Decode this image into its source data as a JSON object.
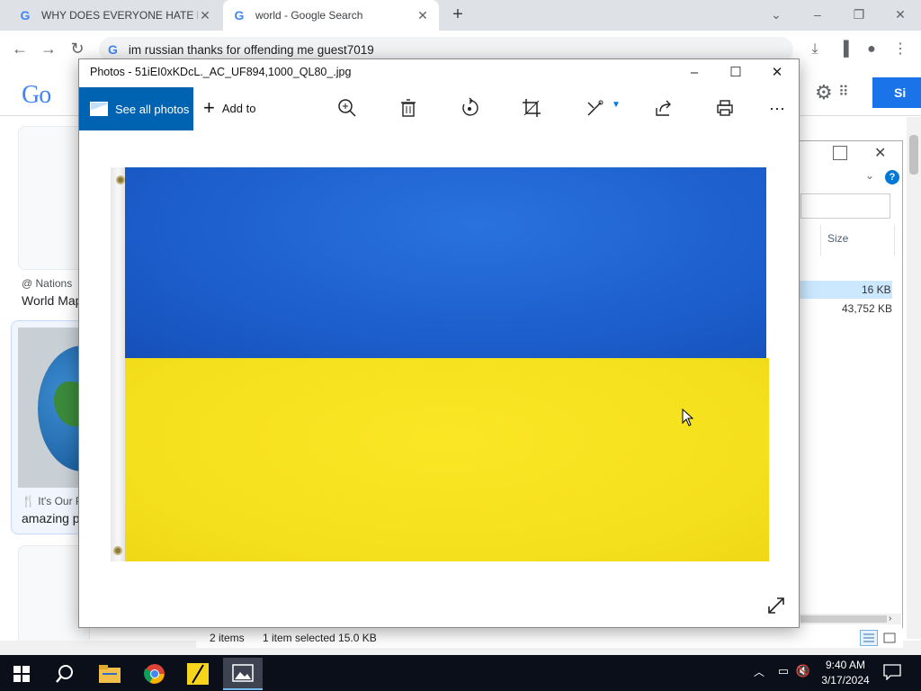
{
  "browser": {
    "tabs": [
      {
        "title": "WHY DOES EVERYONE HATE RUS",
        "favicon": "google-g-icon"
      },
      {
        "title": "world - Google Search",
        "favicon": "google-g-icon"
      }
    ],
    "omnibox_text": "im russian thanks for offending me guest7019",
    "window_controls": [
      "minimize",
      "restore",
      "close"
    ]
  },
  "google_page": {
    "logo_text": "Go",
    "signin_label": "Si",
    "results": [
      {
        "source": "Nations",
        "caption": "World Map"
      },
      {
        "source": "It's Our P",
        "caption": "amazing p"
      }
    ]
  },
  "explorer": {
    "column_size": "Size",
    "rows": [
      {
        "size": "16 KB",
        "selected": true
      },
      {
        "size": "43,752 KB",
        "selected": false
      }
    ],
    "status_items": "2 items",
    "status_selected": "1 item selected  15.0 KB"
  },
  "photos": {
    "title": "Photos - 51iEI0xKDcL._AC_UF894,1000_QL80_.jpg",
    "see_all_label": "See all photos",
    "add_to_label": "Add to",
    "tools": [
      "zoom-icon",
      "delete-icon",
      "rotate-icon",
      "crop-icon",
      "edit-icon",
      "share-icon",
      "print-icon",
      "more-icon"
    ],
    "image_colors": {
      "top": "#1a5bc8",
      "bottom": "#f5e01d"
    }
  },
  "taskbar": {
    "apps": [
      "start-icon",
      "search-icon",
      "file-explorer-icon",
      "chrome-icon",
      "notes-app-icon",
      "photos-app-icon"
    ],
    "time": "9:40 AM",
    "date": "3/17/2024"
  }
}
